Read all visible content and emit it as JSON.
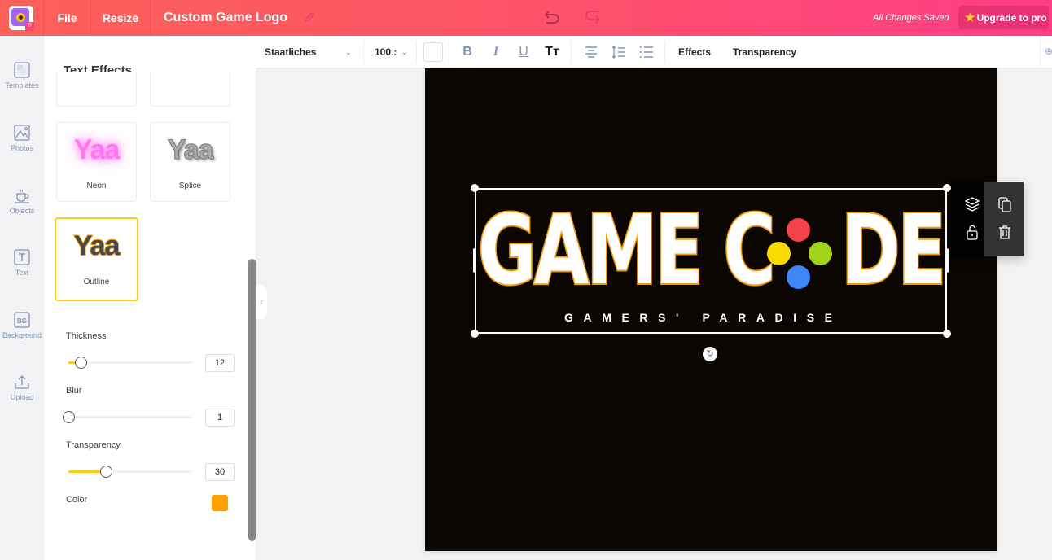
{
  "topbar": {
    "file_label": "File",
    "resize_label": "Resize",
    "document_title": "Custom Game Logo",
    "save_status": "All Changes Saved",
    "upgrade_label": "Upgrade to pro",
    "colors": {
      "gradient_start": "#fb6158",
      "gradient_end": "#ff3d86"
    }
  },
  "sidebar": {
    "items": [
      {
        "label": "Templates",
        "icon": "templates-icon"
      },
      {
        "label": "Photos",
        "icon": "photos-icon"
      },
      {
        "label": "Objects",
        "icon": "cup-icon"
      },
      {
        "label": "Text",
        "icon": "text-icon"
      },
      {
        "label": "Background",
        "icon": "bg-icon"
      },
      {
        "label": "Upload",
        "icon": "upload-icon"
      }
    ]
  },
  "panel": {
    "title": "Text Effects",
    "effects": [
      {
        "label": "Neon",
        "preview": "Yaa"
      },
      {
        "label": "Splice",
        "preview": "Yaa"
      },
      {
        "label": "Outline",
        "preview": "Yaa",
        "selected": true
      }
    ],
    "controls": {
      "thickness": {
        "label": "Thickness",
        "value": "12",
        "fraction": 0.1
      },
      "blur": {
        "label": "Blur",
        "value": "1",
        "fraction": 0.0
      },
      "transparency": {
        "label": "Transparency",
        "value": "30",
        "fraction": 0.3
      },
      "color": {
        "label": "Color",
        "value": "#ffa000"
      }
    }
  },
  "toolbar": {
    "font": "Staatliches",
    "font_size": "100.:",
    "bold": "B",
    "italic": "I",
    "underline": "U",
    "text_case": "Tт",
    "effects_label": "Effects",
    "transparency_label": "Transparency"
  },
  "canvas": {
    "logo_word_1": "GAME C",
    "logo_word_2": "DE",
    "tagline": "GAMERS' PARADISE",
    "dot_colors": {
      "top": "#f5424a",
      "left": "#f8dc00",
      "right": "#9fd41b",
      "bottom": "#3f86f6"
    },
    "outline_color": "#f59a00",
    "background": "#0b0601"
  }
}
